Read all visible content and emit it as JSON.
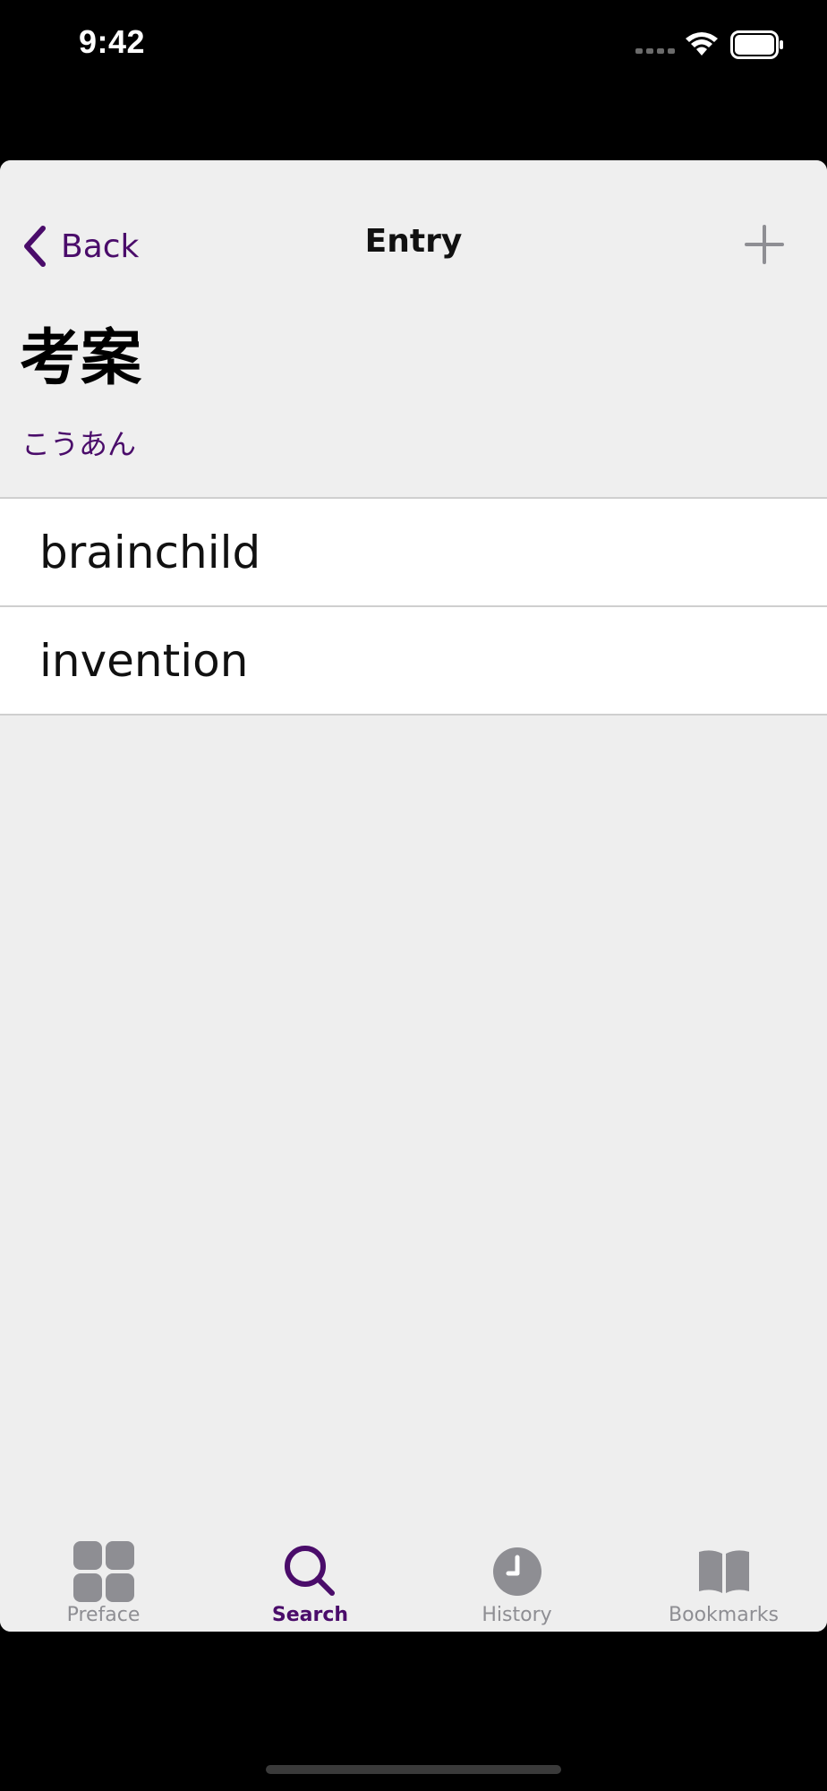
{
  "status_bar": {
    "time": "9:42",
    "signal_icon": "signal-dots-icon",
    "wifi_icon": "wifi-icon",
    "battery_icon": "battery-icon"
  },
  "nav": {
    "back_label": "Back",
    "title": "Entry",
    "add_icon": "plus-icon",
    "accent_color": "#4a0c6a"
  },
  "entry": {
    "headword": "考案",
    "reading": "こうあん",
    "definitions": [
      {
        "text": "brainchild"
      },
      {
        "text": "invention"
      }
    ]
  },
  "tabs": [
    {
      "label": "Preface",
      "icon": "grid-icon",
      "active": false
    },
    {
      "label": "Search",
      "icon": "search-icon",
      "active": true
    },
    {
      "label": "History",
      "icon": "clock-icon",
      "active": false
    },
    {
      "label": "Bookmarks",
      "icon": "book-icon",
      "active": false
    }
  ]
}
